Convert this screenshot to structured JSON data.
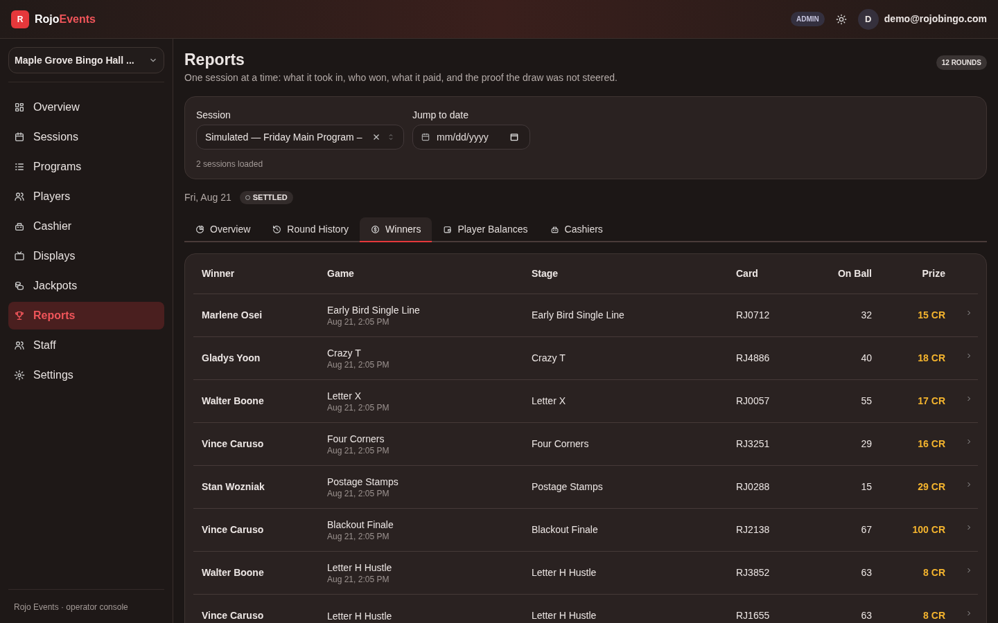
{
  "brand": {
    "badge": "R",
    "name_1": "Rojo",
    "name_2": "Events"
  },
  "header": {
    "role": "ADMIN",
    "avatar": "D",
    "email": "demo@rojobingo.com"
  },
  "sidebar": {
    "venue": "Maple Grove Bingo Hall ...",
    "items": [
      {
        "label": "Overview",
        "selected": false
      },
      {
        "label": "Sessions",
        "selected": false
      },
      {
        "label": "Programs",
        "selected": false
      },
      {
        "label": "Players",
        "selected": false
      },
      {
        "label": "Cashier",
        "selected": false
      },
      {
        "label": "Displays",
        "selected": false
      },
      {
        "label": "Jackpots",
        "selected": false
      },
      {
        "label": "Reports",
        "selected": true
      },
      {
        "label": "Staff",
        "selected": false
      },
      {
        "label": "Settings",
        "selected": false
      }
    ],
    "footer": "Rojo Events · operator console"
  },
  "page": {
    "title": "Reports",
    "rounds": "12 ROUNDS",
    "subtitle": "One session at a time: what it took in, who won, what it paid, and the proof the draw was not steered."
  },
  "filters": {
    "session_label": "Session",
    "session_value": "Simulated — Friday Main Program –",
    "date_label": "Jump to date",
    "date_placeholder": "mm/dd/yyyy",
    "note": "2 sessions loaded"
  },
  "session_date": "Fri, Aug 21",
  "status": "SETTLED",
  "tabs": [
    {
      "label": "Overview",
      "selected": false
    },
    {
      "label": "Round History",
      "selected": false
    },
    {
      "label": "Winners",
      "selected": true
    },
    {
      "label": "Player Balances",
      "selected": false
    },
    {
      "label": "Cashiers",
      "selected": false
    }
  ],
  "table": {
    "columns": [
      "Winner",
      "Game",
      "Stage",
      "Card",
      "On Ball",
      "Prize"
    ],
    "rows": [
      {
        "winner": "Marlene Osei",
        "game": "Early Bird Single Line",
        "time": "Aug 21, 2:05 PM",
        "stage": "Early Bird Single Line",
        "card": "RJ0712",
        "on_ball": "32",
        "prize": "15 CR"
      },
      {
        "winner": "Gladys Yoon",
        "game": "Crazy T",
        "time": "Aug 21, 2:05 PM",
        "stage": "Crazy T",
        "card": "RJ4886",
        "on_ball": "40",
        "prize": "18 CR"
      },
      {
        "winner": "Walter Boone",
        "game": "Letter X",
        "time": "Aug 21, 2:05 PM",
        "stage": "Letter X",
        "card": "RJ0057",
        "on_ball": "55",
        "prize": "17 CR"
      },
      {
        "winner": "Vince Caruso",
        "game": "Four Corners",
        "time": "Aug 21, 2:05 PM",
        "stage": "Four Corners",
        "card": "RJ3251",
        "on_ball": "29",
        "prize": "16 CR"
      },
      {
        "winner": "Stan Wozniak",
        "game": "Postage Stamps",
        "time": "Aug 21, 2:05 PM",
        "stage": "Postage Stamps",
        "card": "RJ0288",
        "on_ball": "15",
        "prize": "29 CR"
      },
      {
        "winner": "Vince Caruso",
        "game": "Blackout Finale",
        "time": "Aug 21, 2:05 PM",
        "stage": "Blackout Finale",
        "card": "RJ2138",
        "on_ball": "67",
        "prize": "100 CR"
      },
      {
        "winner": "Walter Boone",
        "game": "Letter H Hustle",
        "time": "Aug 21, 2:05 PM",
        "stage": "Letter H Hustle",
        "card": "RJ3852",
        "on_ball": "63",
        "prize": "8 CR"
      },
      {
        "winner": "Vince Caruso",
        "game": "Letter H Hustle",
        "stage": "Letter H Hustle",
        "card": "RJ1655",
        "on_ball": "63",
        "prize": "8 CR"
      }
    ]
  }
}
